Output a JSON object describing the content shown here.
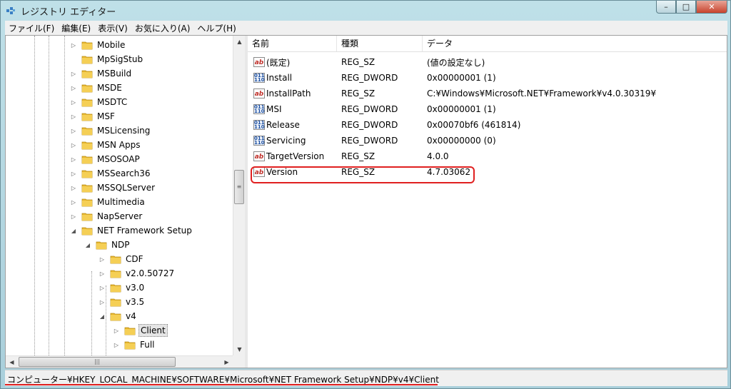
{
  "window": {
    "title": "レジストリ エディター",
    "caption": {
      "minimize": "–",
      "maximize": "□",
      "close": "✕"
    }
  },
  "menubar": [
    "ファイル(F)",
    "編集(E)",
    "表示(V)",
    "お気に入り(A)",
    "ヘルプ(H)"
  ],
  "tree": [
    {
      "label": "Mobile",
      "level": 0,
      "state": "collapsed"
    },
    {
      "label": "MpSigStub",
      "level": 0,
      "state": "leaf"
    },
    {
      "label": "MSBuild",
      "level": 0,
      "state": "collapsed"
    },
    {
      "label": "MSDE",
      "level": 0,
      "state": "collapsed"
    },
    {
      "label": "MSDTC",
      "level": 0,
      "state": "collapsed"
    },
    {
      "label": "MSF",
      "level": 0,
      "state": "collapsed"
    },
    {
      "label": "MSLicensing",
      "level": 0,
      "state": "collapsed"
    },
    {
      "label": "MSN Apps",
      "level": 0,
      "state": "collapsed"
    },
    {
      "label": "MSOSOAP",
      "level": 0,
      "state": "collapsed"
    },
    {
      "label": "MSSearch36",
      "level": 0,
      "state": "collapsed"
    },
    {
      "label": "MSSQLServer",
      "level": 0,
      "state": "collapsed"
    },
    {
      "label": "Multimedia",
      "level": 0,
      "state": "collapsed"
    },
    {
      "label": "NapServer",
      "level": 0,
      "state": "collapsed"
    },
    {
      "label": "NET Framework Setup",
      "level": 0,
      "state": "expanded"
    },
    {
      "label": "NDP",
      "level": 1,
      "state": "expanded"
    },
    {
      "label": "CDF",
      "level": 2,
      "state": "collapsed"
    },
    {
      "label": "v2.0.50727",
      "level": 2,
      "state": "collapsed"
    },
    {
      "label": "v3.0",
      "level": 2,
      "state": "collapsed"
    },
    {
      "label": "v3.5",
      "level": 2,
      "state": "collapsed"
    },
    {
      "label": "v4",
      "level": 2,
      "state": "expanded"
    },
    {
      "label": "Client",
      "level": 3,
      "state": "collapsed",
      "selected": true
    },
    {
      "label": "Full",
      "level": 3,
      "state": "collapsed"
    }
  ],
  "list": {
    "headers": {
      "name": "名前",
      "type": "種類",
      "data": "データ"
    },
    "rows": [
      {
        "icon": "string-value-icon",
        "name": "(既定)",
        "type": "REG_SZ",
        "data": "(値の設定なし)"
      },
      {
        "icon": "dword-value-icon",
        "name": "Install",
        "type": "REG_DWORD",
        "data": "0x00000001 (1)"
      },
      {
        "icon": "string-value-icon",
        "name": "InstallPath",
        "type": "REG_SZ",
        "data": "C:¥Windows¥Microsoft.NET¥Framework¥v4.0.30319¥"
      },
      {
        "icon": "dword-value-icon",
        "name": "MSI",
        "type": "REG_DWORD",
        "data": "0x00000001 (1)"
      },
      {
        "icon": "dword-value-icon",
        "name": "Release",
        "type": "REG_DWORD",
        "data": "0x00070bf6 (461814)"
      },
      {
        "icon": "dword-value-icon",
        "name": "Servicing",
        "type": "REG_DWORD",
        "data": "0x00000000 (0)"
      },
      {
        "icon": "string-value-icon",
        "name": "TargetVersion",
        "type": "REG_SZ",
        "data": "4.0.0"
      },
      {
        "icon": "string-value-icon",
        "name": "Version",
        "type": "REG_SZ",
        "data": "4.7.03062",
        "highlighted": true
      }
    ]
  },
  "icons": {
    "string_glyph": "ab",
    "dword_glyph": "011\n110"
  },
  "status": {
    "path": "コンピューター¥HKEY_LOCAL_MACHINE¥SOFTWARE¥Microsoft¥NET Framework Setup¥NDP¥v4¥Client"
  },
  "colors": {
    "highlight": "#e02020",
    "folder": "#e8b830"
  }
}
